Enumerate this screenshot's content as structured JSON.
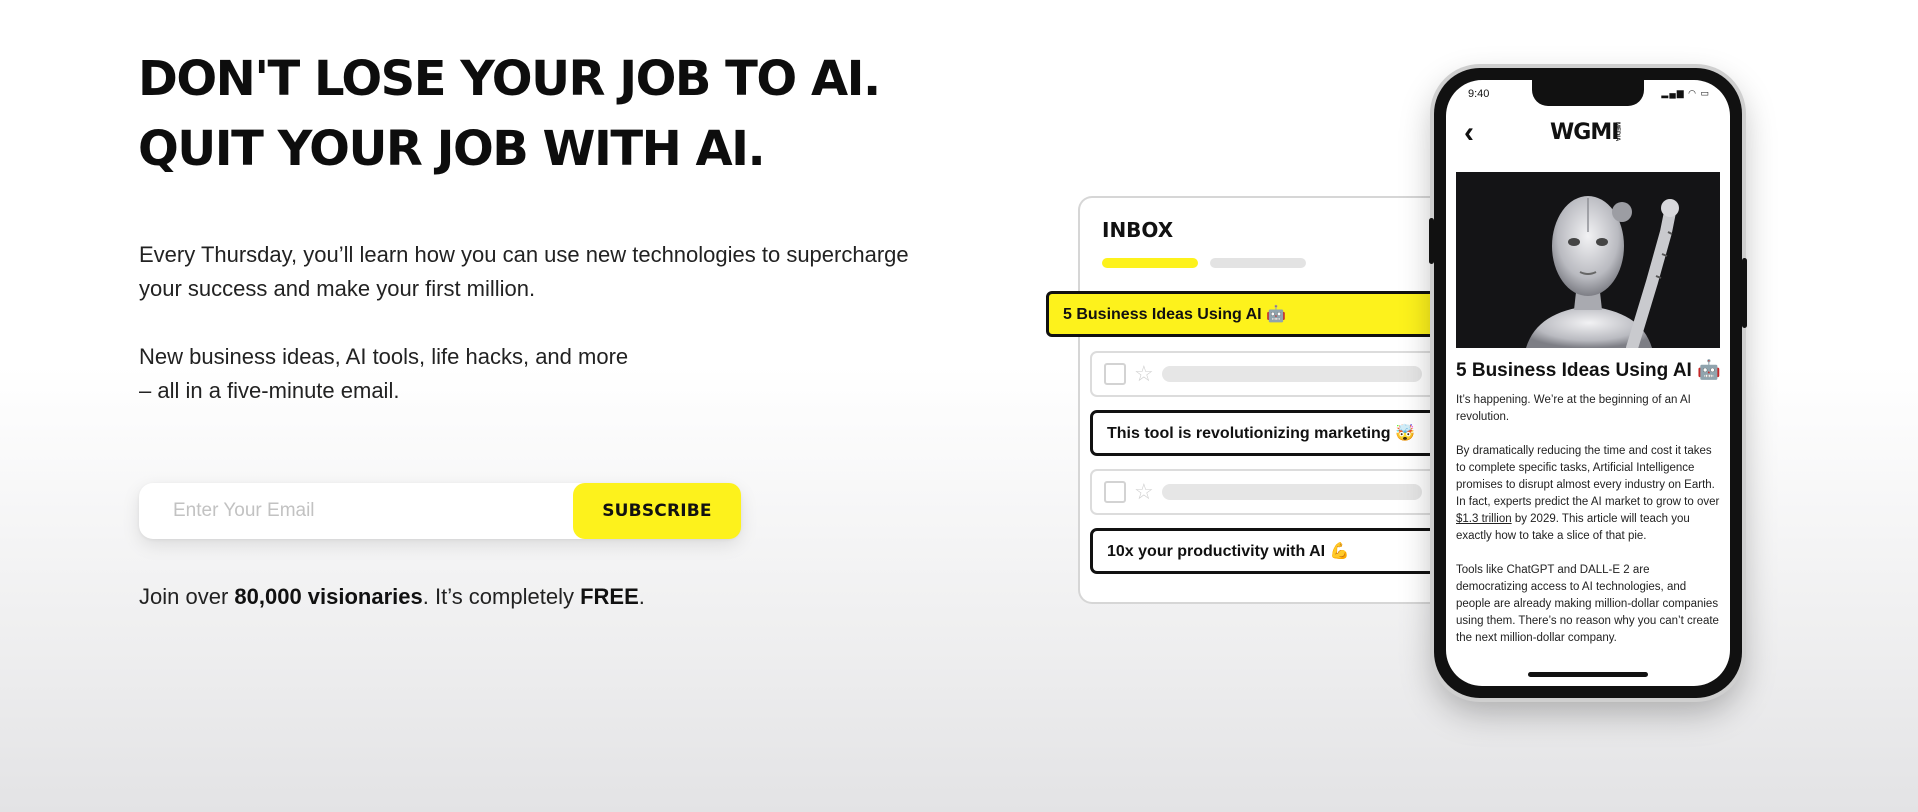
{
  "hero": {
    "headline_line1": "DON'T LOSE YOUR JOB TO AI.",
    "headline_line2": "QUIT YOUR JOB WITH AI.",
    "para1_line1": "Every Thursday, you’ll learn how you can use new technologies to supercharge",
    "para1_line2": "your success and make your first million.",
    "para2_line1": "New business ideas, AI tools, life hacks, and more",
    "para2_line2": "– all in a five-minute email."
  },
  "signup": {
    "email_placeholder": "Enter Your Email",
    "button_label": "SUBSCRIBE"
  },
  "join": {
    "prefix": "Join over ",
    "count": "80,000 visionaries",
    "middle": ". It’s completely ",
    "free": "FREE",
    "suffix": "."
  },
  "inbox": {
    "title": "INBOX",
    "featured_email": "5 Business Ideas Using AI 🤖",
    "email_2": "This tool is revolutionizing marketing 🤯",
    "email_3": "10x your productivity with AI 💪"
  },
  "phone": {
    "status_time": "9:40",
    "logo": "WGMI",
    "logo_sub": "MEDIA",
    "article_title": "5 Business Ideas Using AI 🤖",
    "p1": "It’s happening. We’re at the beginning of an AI revolution.",
    "p2_start": "By dramatically reducing the time and cost it takes to complete specific tasks, Artificial Intelligence promises to disrupt almost every industry on Earth. In fact, experts predict the AI market to grow to over ",
    "p2_link": "$1.3 trillion",
    "p2_end": " by 2029. This article will teach you exactly how to take a slice of that pie.",
    "p3": "Tools like ChatGPT and DALL-E 2 are democratizing access to AI technologies, and people are already making million-dollar companies using them. There’s no reason why you can’t create the next million-dollar company."
  },
  "colors": {
    "accent_yellow": "#fdf21c",
    "text_dark": "#111111"
  }
}
